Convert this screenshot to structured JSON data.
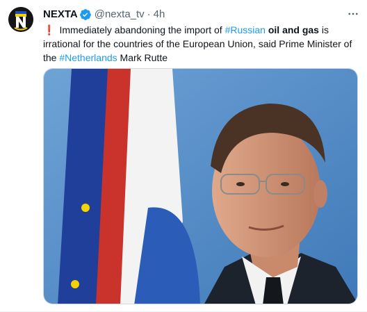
{
  "tweet": {
    "author": {
      "display_name": "NEXTA",
      "handle": "@nexta_tv",
      "separator": "·",
      "timestamp": "4h",
      "avatar_icon": "nexta-logo-icon",
      "verified_icon": "verified-badge-icon",
      "verified_color": "#1d9bf0"
    },
    "more_icon": "more-options-icon",
    "text": {
      "prefix_icon": "❗",
      "part1": "Immediately abandoning the import of ",
      "hashtag1": "#Russian",
      "bold": "oil and gas",
      "part2": " is irrational for the countries of the European Union, said Prime Minister of the ",
      "hashtag2": "#Netherlands",
      "part3": " Mark Rutte"
    },
    "media": {
      "description_icon": "photo-image"
    },
    "colors": {
      "link": "#1d9bf0",
      "text": "#0f1419",
      "secondary": "#536471"
    }
  }
}
